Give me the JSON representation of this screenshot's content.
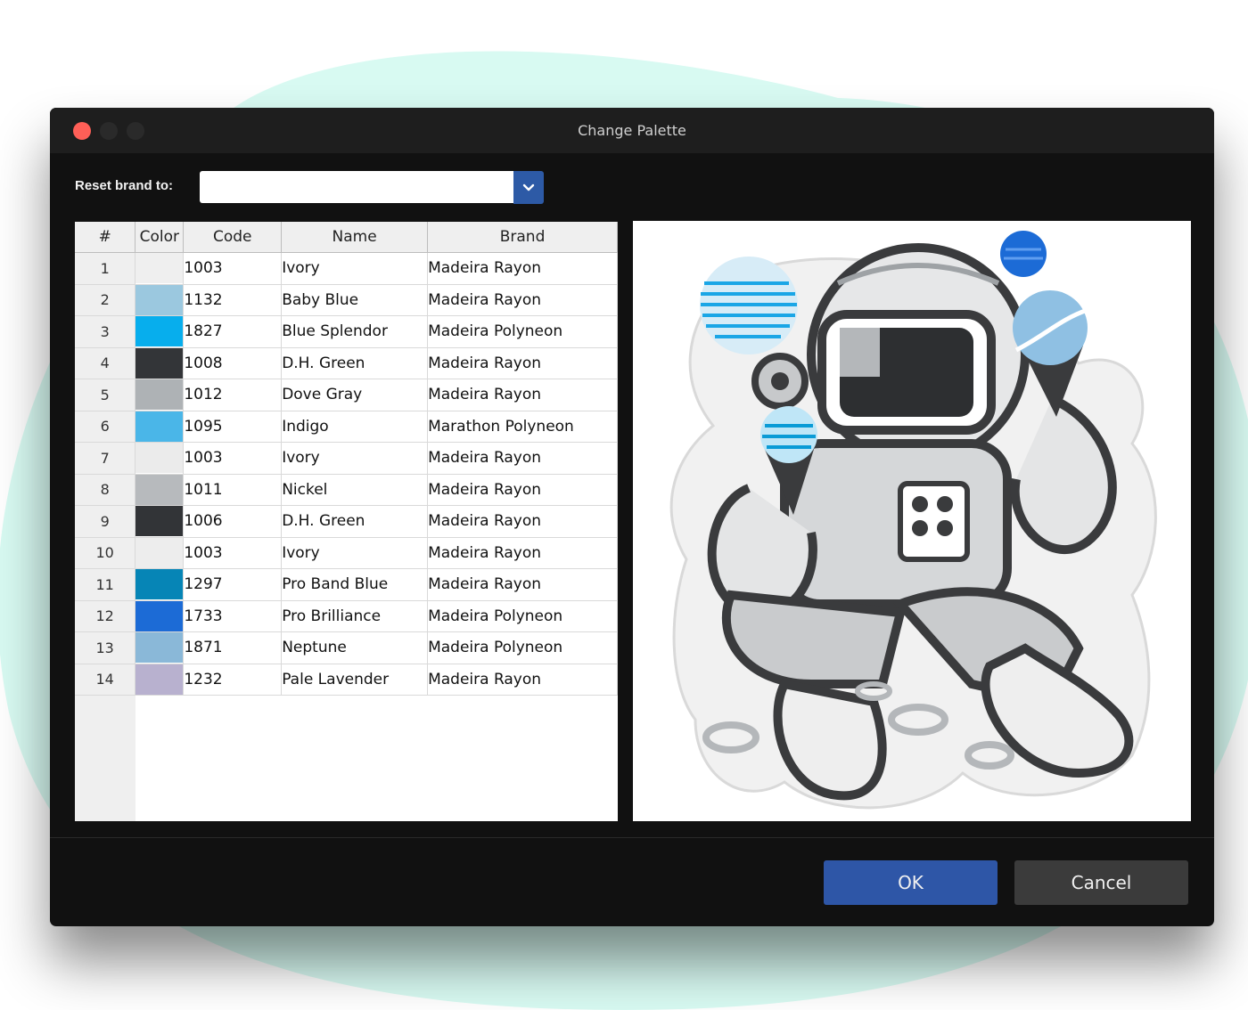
{
  "window": {
    "title": "Change Palette"
  },
  "toolbar": {
    "reset_label": "Reset brand to:",
    "brand_select_value": ""
  },
  "table": {
    "headers": {
      "num": "#",
      "color": "Color",
      "code": "Code",
      "name": "Name",
      "brand": "Brand"
    },
    "rows": [
      {
        "num": "1",
        "color": "#efefef",
        "code": "1003",
        "name": "Ivory",
        "brand": "Madeira Rayon"
      },
      {
        "num": "2",
        "color": "#9bc8df",
        "code": "1132",
        "name": "Baby Blue",
        "brand": "Madeira Rayon"
      },
      {
        "num": "3",
        "color": "#07aeed",
        "code": "1827",
        "name": "Blue Splendor",
        "brand": "Madeira Polyneon"
      },
      {
        "num": "4",
        "color": "#333538",
        "code": "1008",
        "name": "D.H. Green",
        "brand": "Madeira Rayon"
      },
      {
        "num": "5",
        "color": "#aeb2b5",
        "code": "1012",
        "name": "Dove Gray",
        "brand": "Madeira Rayon"
      },
      {
        "num": "6",
        "color": "#4ab6e8",
        "code": "1095",
        "name": "Indigo",
        "brand": "Marathon Polyneon"
      },
      {
        "num": "7",
        "color": "#ebebeb",
        "code": "1003",
        "name": "Ivory",
        "brand": "Madeira Rayon"
      },
      {
        "num": "8",
        "color": "#b7babd",
        "code": "1011",
        "name": "Nickel",
        "brand": "Madeira Rayon"
      },
      {
        "num": "9",
        "color": "#323437",
        "code": "1006",
        "name": "D.H. Green",
        "brand": "Madeira Rayon"
      },
      {
        "num": "10",
        "color": "#ededed",
        "code": "1003",
        "name": "Ivory",
        "brand": "Madeira Rayon"
      },
      {
        "num": "11",
        "color": "#0685b6",
        "code": "1297",
        "name": "Pro Band Blue",
        "brand": "Madeira Rayon"
      },
      {
        "num": "12",
        "color": "#1c6bd6",
        "code": "1733",
        "name": "Pro Brilliance",
        "brand": "Madeira Polyneon"
      },
      {
        "num": "13",
        "color": "#8ab8d8",
        "code": "1871",
        "name": "Neptune",
        "brand": "Madeira Polyneon"
      },
      {
        "num": "14",
        "color": "#b8b1cf",
        "code": "1232",
        "name": "Pale Lavender",
        "brand": "Madeira Rayon"
      }
    ]
  },
  "buttons": {
    "ok": "OK",
    "cancel": "Cancel"
  },
  "colors": {
    "accent": "#2e56a7",
    "close": "#ff5f57",
    "background_blob": "#d8faf2"
  }
}
